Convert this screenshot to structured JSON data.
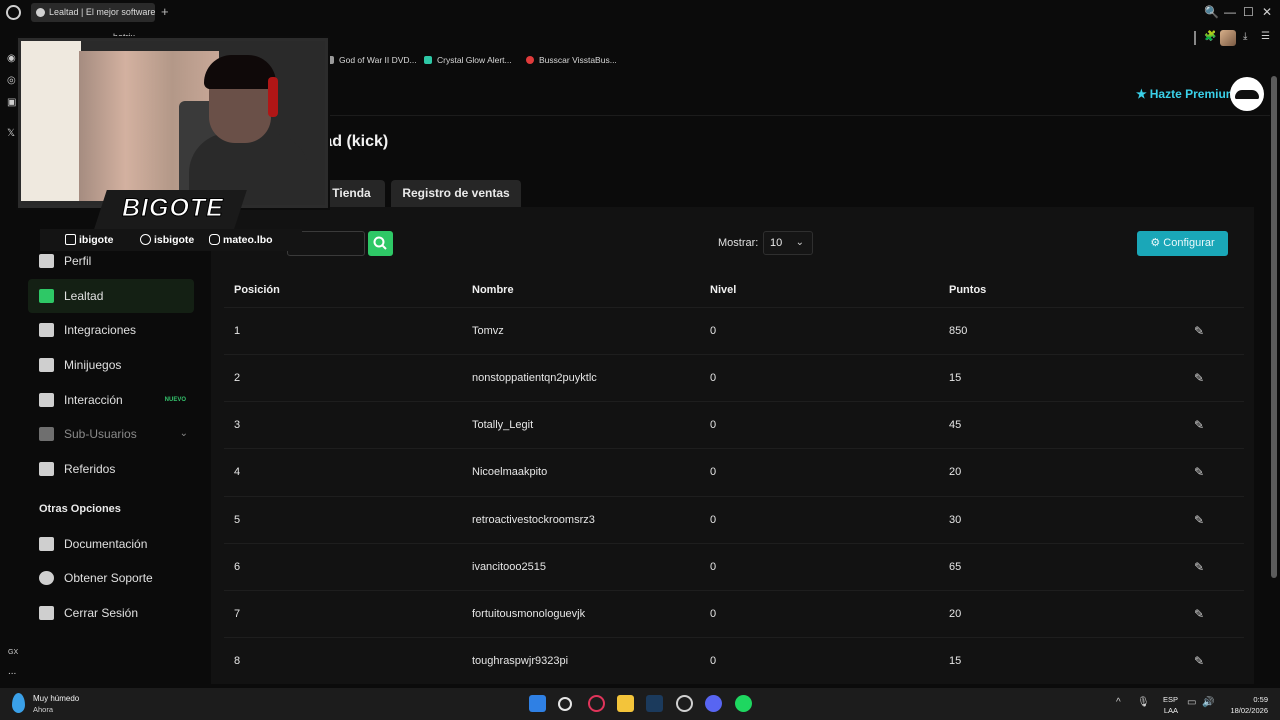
{
  "browser": {
    "tab_title": "Lealtad | El mejor software",
    "new_tab": "+",
    "url": "botrix.",
    "bookmarks": [
      {
        "label": "God of War II DVD...",
        "color": "#9a9a9a"
      },
      {
        "label": "Crystal Glow Alert...",
        "color": "#2ec8a6"
      },
      {
        "label": "Busscar VisstaBus...",
        "color": "#e03b3b"
      }
    ],
    "window_controls": [
      "🔍",
      "—",
      "☐",
      "✕"
    ],
    "toolbar_icons": [
      "🧩",
      "⤓",
      "☰"
    ]
  },
  "side_strip": {
    "icons": [
      "◉",
      "◎",
      "▣",
      "𝕏"
    ],
    "bottom": {
      "gx": "GX",
      "more": "..."
    }
  },
  "header": {
    "premium_label": "Hazte Premium",
    "star": "★"
  },
  "page": {
    "title": "tad (kick)",
    "tabs": [
      "Tienda",
      "Registro de ventas"
    ]
  },
  "sidebar": {
    "items": [
      {
        "label": "Perfil",
        "badge": ""
      },
      {
        "label": "Lealtad",
        "badge": ""
      },
      {
        "label": "Integraciones",
        "badge": ""
      },
      {
        "label": "Minijuegos",
        "badge": ""
      },
      {
        "label": "Interacción",
        "badge": "NUEVO"
      },
      {
        "label": "Sub-Usuarios",
        "badge": ""
      },
      {
        "label": "Referidos",
        "badge": ""
      }
    ],
    "section_title": "Otras Opciones",
    "other_items": [
      {
        "label": "Documentación"
      },
      {
        "label": "Obtener Soporte"
      },
      {
        "label": "Cerrar Sesión"
      }
    ],
    "chevron": "⌄"
  },
  "toolbar": {
    "search_icon": "🔍",
    "show_label": "Mostrar:",
    "show_value": "10",
    "select_arrow": "⌄",
    "config_label": "Configurar",
    "config_icon": "⚙"
  },
  "table": {
    "headers": [
      "Posición",
      "Nombre",
      "Nivel",
      "Puntos"
    ],
    "edit_icon": "✎",
    "rows": [
      {
        "pos": "1",
        "name": "Tomvz",
        "level": "0",
        "points": "850"
      },
      {
        "pos": "2",
        "name": "nonstoppatientqn2puyktlc",
        "level": "0",
        "points": "15"
      },
      {
        "pos": "3",
        "name": "Totally_Legit",
        "level": "0",
        "points": "45"
      },
      {
        "pos": "4",
        "name": "Nicoelmaakpito",
        "level": "0",
        "points": "20"
      },
      {
        "pos": "5",
        "name": "retroactivestockroomsrz3",
        "level": "0",
        "points": "30"
      },
      {
        "pos": "6",
        "name": "ivancitooo2515",
        "level": "0",
        "points": "65"
      },
      {
        "pos": "7",
        "name": "fortuitousmonologuevjk",
        "level": "0",
        "points": "20"
      },
      {
        "pos": "8",
        "name": "toughraspwjr9323pi",
        "level": "0",
        "points": "15"
      }
    ]
  },
  "overlay": {
    "brand": "BIGOTE",
    "socials": [
      {
        "handle": "ibigote",
        "icon": "twitch-kick-icon"
      },
      {
        "handle": "isbigote",
        "icon": "tiktok-icon"
      },
      {
        "handle": "mateo.lbo",
        "icon": "instagram-icon"
      }
    ]
  },
  "taskbar": {
    "weather_main": "Muy húmedo",
    "weather_sub": "Ahora",
    "lang_top": "ESP",
    "lang_bottom": "LAA",
    "time": "0:59",
    "date": "18/02/2026",
    "tray_icons": [
      "^",
      "🎙",
      "▭",
      "🔊",
      "🔋"
    ]
  }
}
